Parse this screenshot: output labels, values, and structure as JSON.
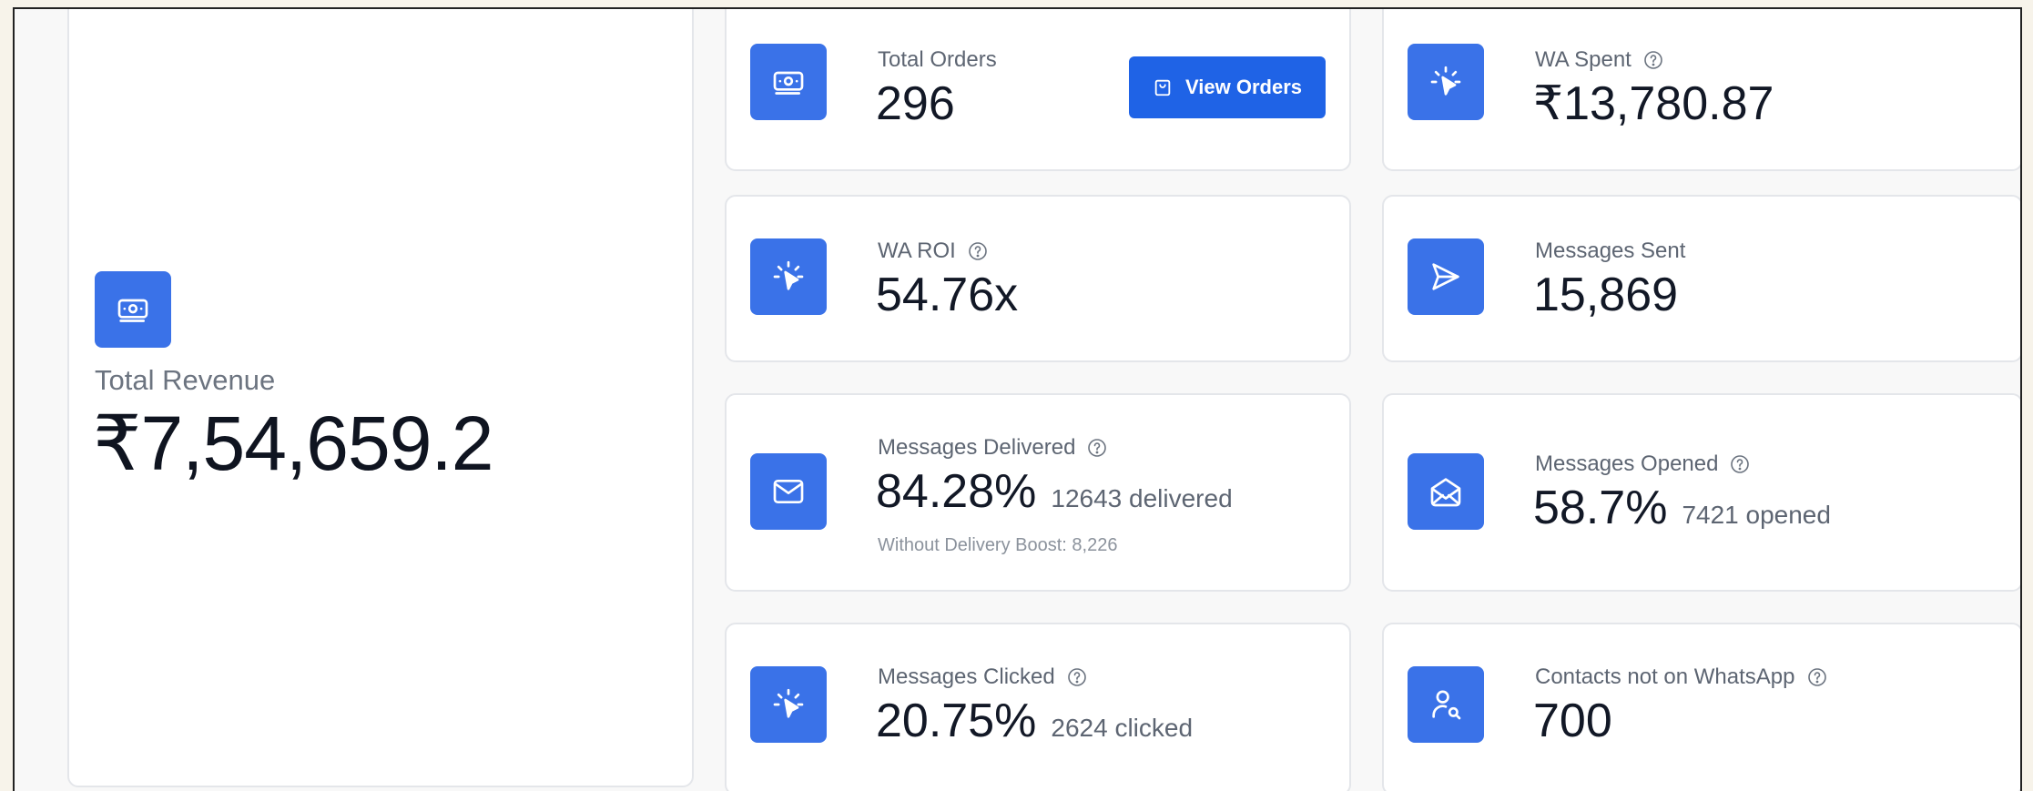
{
  "revenue": {
    "label": "Total Revenue",
    "value": "₹7,54,659.2",
    "icon": "money-icon"
  },
  "stats": {
    "total_orders": {
      "label": "Total Orders",
      "value": "296",
      "icon": "money-icon",
      "button_label": "View Orders",
      "button_icon": "shopping-bag-icon"
    },
    "wa_spent": {
      "label": "WA Spent",
      "value": "₹13,780.87",
      "icon": "cursor-click-icon",
      "help": true
    },
    "wa_roi": {
      "label": "WA ROI",
      "value": "54.76x",
      "icon": "cursor-click-icon",
      "help": true
    },
    "messages_sent": {
      "label": "Messages Sent",
      "value": "15,869",
      "icon": "send-icon"
    },
    "messages_delivered": {
      "label": "Messages Delivered",
      "value": "84.28%",
      "sub": "12643 delivered",
      "note": "Without Delivery Boost: 8,226",
      "icon": "mail-icon",
      "help": true
    },
    "messages_opened": {
      "label": "Messages Opened",
      "value": "58.7%",
      "sub": "7421 opened",
      "icon": "mail-open-icon",
      "help": true
    },
    "messages_clicked": {
      "label": "Messages Clicked",
      "value": "20.75%",
      "sub": "2624 clicked",
      "icon": "cursor-click-icon",
      "help": true
    },
    "contacts_not_on_whatsapp": {
      "label": "Contacts not on WhatsApp",
      "value": "700",
      "icon": "user-search-icon",
      "help": true
    }
  },
  "colors": {
    "accent": "#3a72e8",
    "button": "#1f63e6",
    "background": "#f8f8f8",
    "card_border": "#e4e6ea"
  }
}
